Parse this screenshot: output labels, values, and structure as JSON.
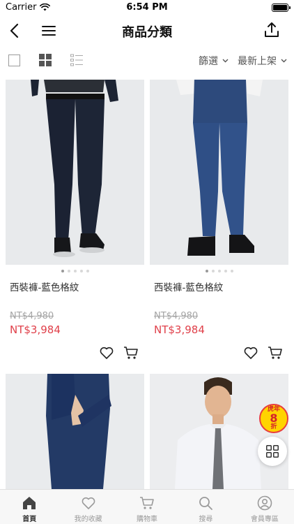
{
  "status_bar": {
    "carrier": "Carrier",
    "time": "6:54 PM"
  },
  "nav": {
    "title": "商品分類",
    "back_icon": "back-icon",
    "menu_icon": "hamburger-menu-icon",
    "share_icon": "share-icon"
  },
  "toolbar": {
    "filter_label": "篩選",
    "sort_label": "最新上架"
  },
  "products": [
    {
      "name": "西裝褲-藍色格紋",
      "original_price": "NT$4,980",
      "sale_price": "NT$3,984"
    },
    {
      "name": "西裝褲-藍色格紋",
      "original_price": "NT$4,980",
      "sale_price": "NT$3,984"
    }
  ],
  "promo": {
    "top": "虎年",
    "number": "8",
    "unit": "折"
  },
  "tabs": [
    {
      "label": "首頁",
      "icon": "home-icon",
      "active": true
    },
    {
      "label": "我的收藏",
      "icon": "heart-icon",
      "active": false
    },
    {
      "label": "購物車",
      "icon": "cart-icon",
      "active": false
    },
    {
      "label": "搜尋",
      "icon": "search-icon",
      "active": false
    },
    {
      "label": "會員專區",
      "icon": "user-icon",
      "active": false
    }
  ],
  "colors": {
    "sale_price": "#e0404a",
    "strike_price": "#a5a5a5",
    "tab_bar": "#f7f7f7",
    "promo_yellow": "#ffd400"
  }
}
